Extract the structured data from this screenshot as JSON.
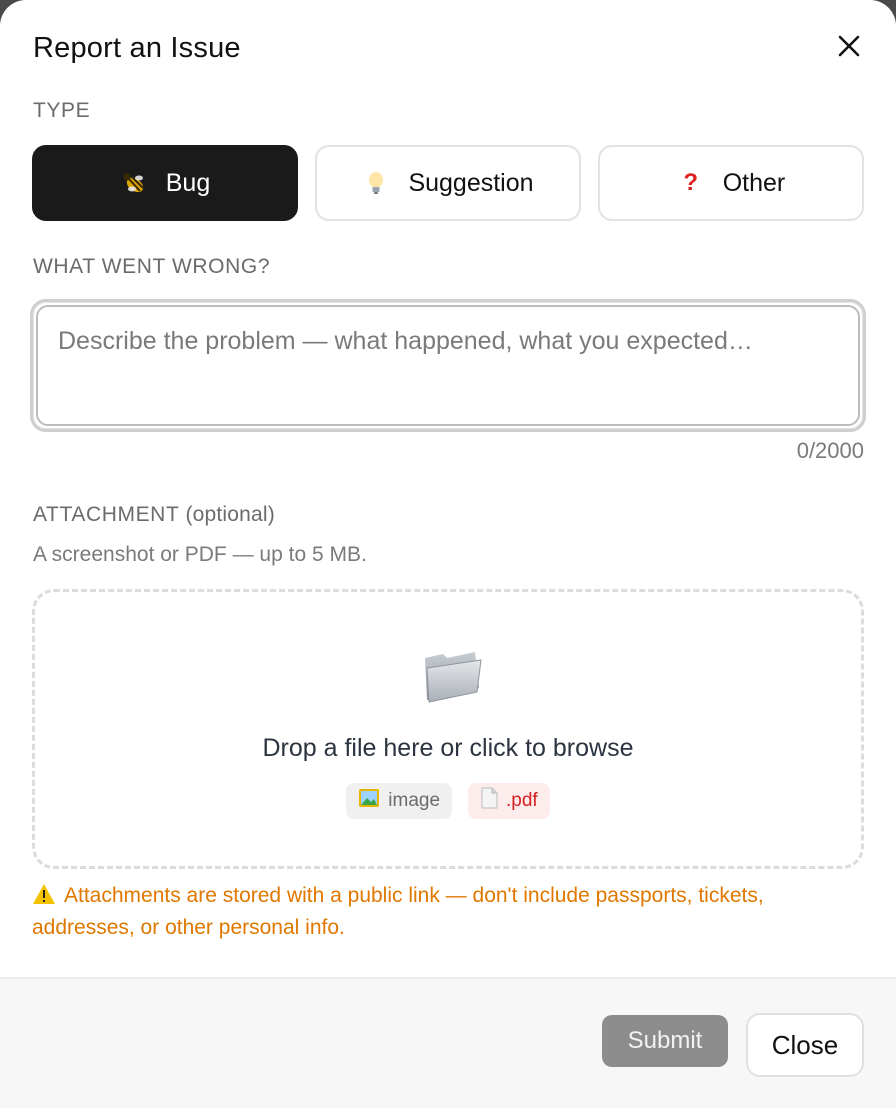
{
  "dialog": {
    "title": "Report an Issue",
    "close_icon": "close-icon"
  },
  "type_section": {
    "label": "TYPE",
    "options": [
      {
        "label": "Bug",
        "icon": "bug-icon",
        "selected": true
      },
      {
        "label": "Suggestion",
        "icon": "lightbulb-icon",
        "selected": false
      },
      {
        "label": "Other",
        "icon": "question-mark-icon",
        "selected": false
      }
    ]
  },
  "description": {
    "label": "WHAT WENT WRONG?",
    "placeholder": "Describe the problem — what happened, what you expected…",
    "value": "",
    "counter": "0/2000"
  },
  "attachment": {
    "label": "ATTACHMENT",
    "optional": "(optional)",
    "hint": "A screenshot or PDF — up to 5 MB.",
    "drop_text": "Drop a file here or click to browse",
    "icon": "folder-icon",
    "chips": [
      {
        "label": "image",
        "icon": "image-icon"
      },
      {
        "label": ".pdf",
        "icon": "document-icon"
      }
    ]
  },
  "warning": {
    "icon": "warning-icon",
    "text": "Attachments are stored with a public link — don't include passports, tickets, addresses, or other personal info."
  },
  "footer": {
    "submit_label": "Submit",
    "close_label": "Close"
  },
  "colors": {
    "selected_bg": "#1a1a1a",
    "warning": "#e07800",
    "pdf_chip": "#d62020",
    "submit_disabled": "#8d8d8d"
  }
}
